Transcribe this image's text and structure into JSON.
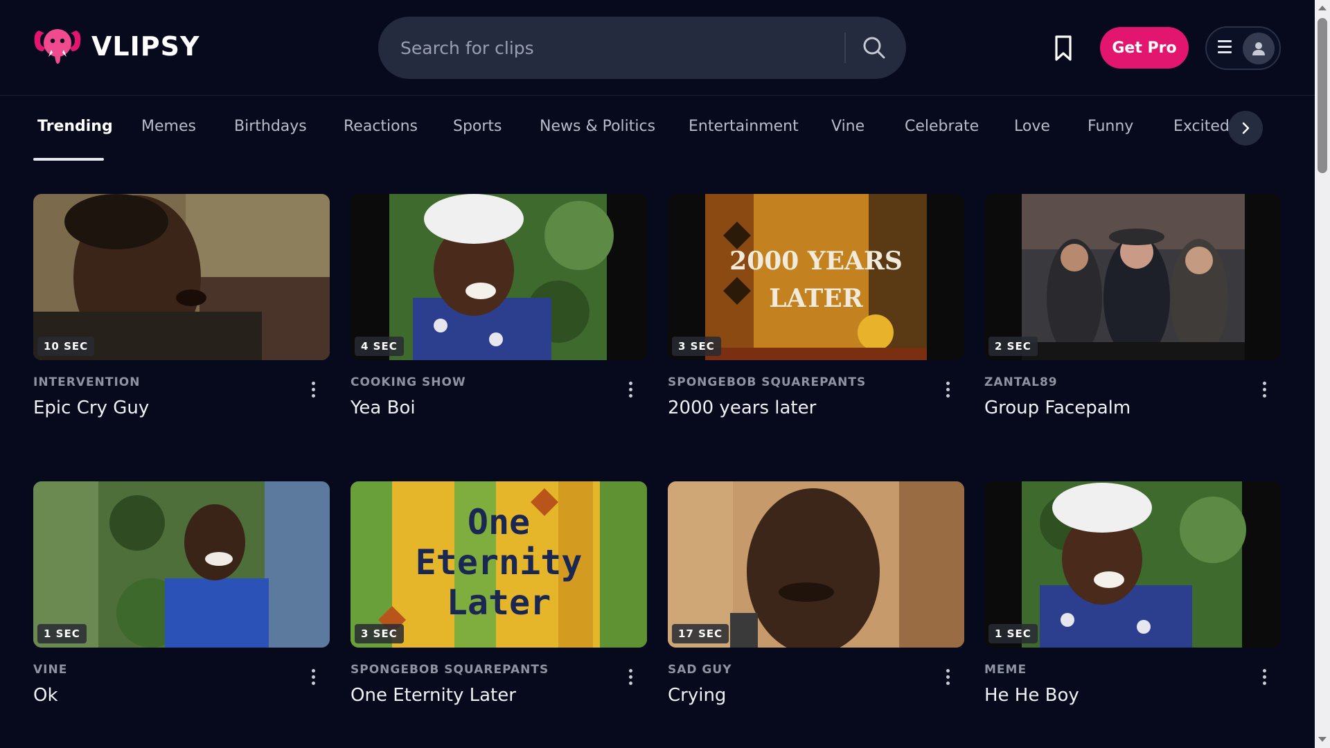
{
  "brand": {
    "name": "VLIPSY",
    "accent": "#e3166f"
  },
  "search": {
    "placeholder": "Search for clips",
    "value": ""
  },
  "header": {
    "bookmark_icon": "bookmark-icon",
    "get_pro_label": "Get Pro",
    "menu_icon": "hamburger-icon",
    "avatar_icon": "user-icon"
  },
  "tabs": [
    {
      "label": "Trending",
      "active": true
    },
    {
      "label": "Memes"
    },
    {
      "label": "Birthdays"
    },
    {
      "label": "Reactions"
    },
    {
      "label": "Sports"
    },
    {
      "label": "News & Politics"
    },
    {
      "label": "Entertainment"
    },
    {
      "label": "Vine"
    },
    {
      "label": "Celebrate"
    },
    {
      "label": "Love"
    },
    {
      "label": "Funny"
    },
    {
      "label": "Excited"
    }
  ],
  "clips": [
    {
      "duration": "10 SEC",
      "source": "INTERVENTION",
      "title": "Epic Cry Guy"
    },
    {
      "duration": "4 SEC",
      "source": "COOKING SHOW",
      "title": "Yea Boi"
    },
    {
      "duration": "3 SEC",
      "source": "SPONGEBOB SQUAREPANTS",
      "title": "2000 years later",
      "caption": [
        "2000 YEARS",
        "LATER"
      ]
    },
    {
      "duration": "2 SEC",
      "source": "ZANTAL89",
      "title": "Group Facepalm"
    },
    {
      "duration": "1 SEC",
      "source": "VINE",
      "title": "Ok"
    },
    {
      "duration": "3 SEC",
      "source": "SPONGEBOB SQUAREPANTS",
      "title": "One Eternity Later",
      "caption": [
        "One",
        "Eternity",
        "Later"
      ]
    },
    {
      "duration": "17 SEC",
      "source": "SAD GUY",
      "title": "Crying"
    },
    {
      "duration": "1 SEC",
      "source": "MEME",
      "title": "He He Boy"
    }
  ]
}
